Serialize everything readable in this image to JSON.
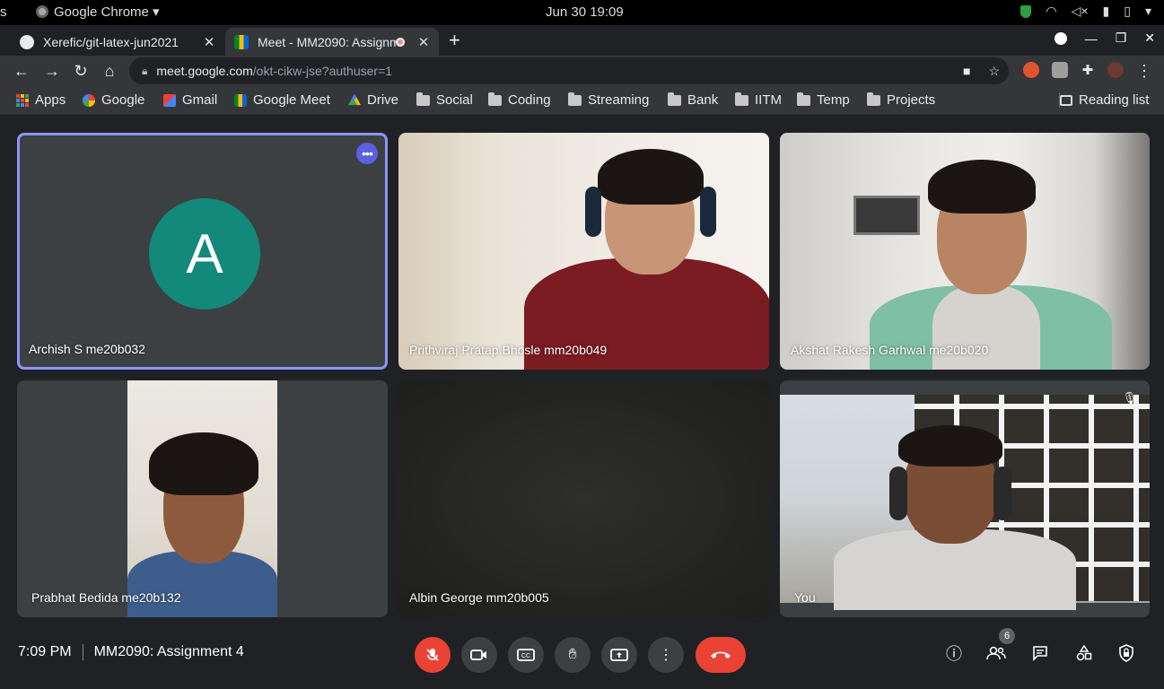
{
  "os": {
    "left_fragment": "s",
    "app_name": "Google Chrome ▾",
    "clock": "Jun 30  19:09"
  },
  "tabs": [
    {
      "title": "Xerefic/git-latex-jun2021",
      "close": "✕"
    },
    {
      "title": "Meet - MM2090: Assignm",
      "close": "✕"
    }
  ],
  "newtab": "+",
  "address": {
    "host": "meet.google.com",
    "path": "/okt-cikw-jse?authuser=1"
  },
  "bookmarks": [
    {
      "label": "Apps",
      "icon": "apps-grid"
    },
    {
      "label": "Google",
      "icon": "google-icon"
    },
    {
      "label": "Gmail",
      "icon": "gmail-icon"
    },
    {
      "label": "Google Meet",
      "icon": "meet-icon"
    },
    {
      "label": "Drive",
      "icon": "drive-icon"
    },
    {
      "label": "Social",
      "icon": "folder-icon"
    },
    {
      "label": "Coding",
      "icon": "folder-icon"
    },
    {
      "label": "Streaming",
      "icon": "folder-icon"
    },
    {
      "label": "Bank",
      "icon": "folder-icon"
    },
    {
      "label": "IITM",
      "icon": "folder-icon"
    },
    {
      "label": "Temp",
      "icon": "folder-icon"
    },
    {
      "label": "Projects",
      "icon": "folder-icon"
    }
  ],
  "reading_list": "Reading list",
  "participants": [
    {
      "name": "Archish S me20b032",
      "avatar_letter": "A"
    },
    {
      "name": "Prithviraj Pratap Bhosle mm20b049"
    },
    {
      "name": "Akshat Rakesh Garhwal me20b020"
    },
    {
      "name": "Prabhat Bedida me20b132"
    },
    {
      "name": "Albin George mm20b005"
    },
    {
      "name": "You"
    }
  ],
  "meeting": {
    "time": "7:09 PM",
    "title": "MM2090: Assignment 4",
    "participant_count": "6"
  },
  "colors": {
    "avatar": "#12897b",
    "active_border": "#8d95ff",
    "end_call": "#ea4335"
  }
}
